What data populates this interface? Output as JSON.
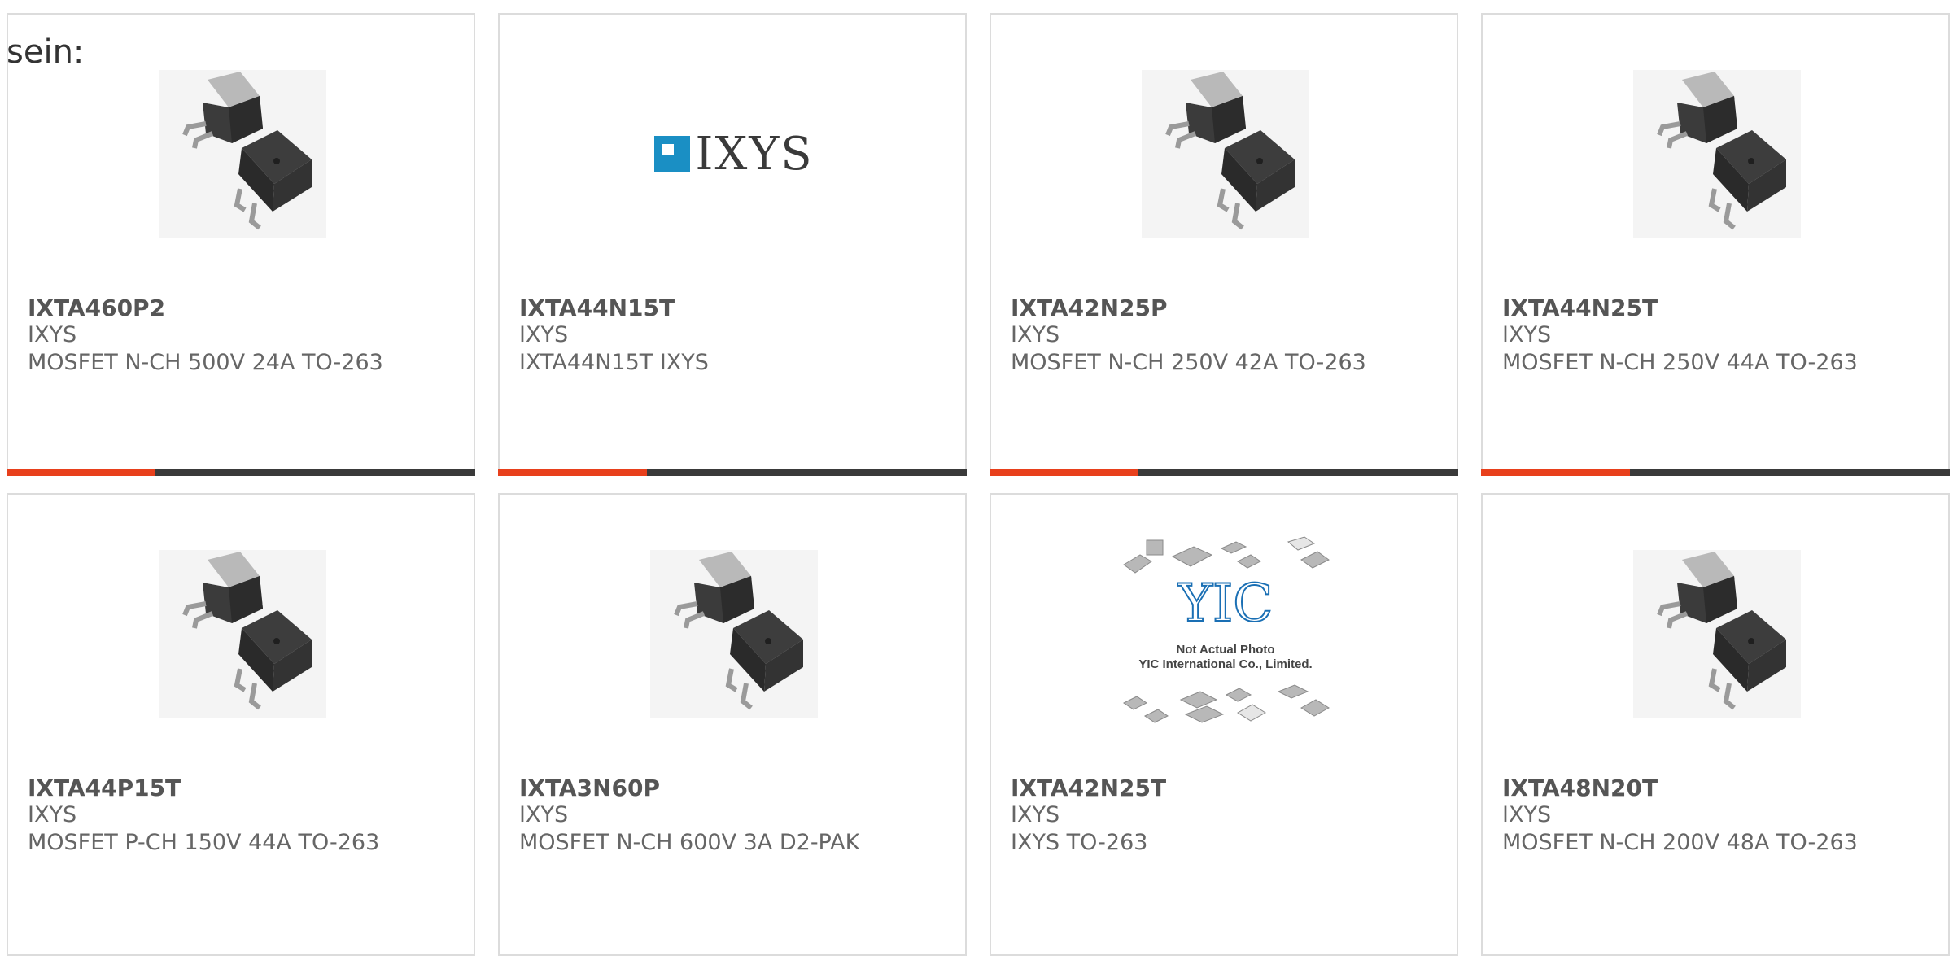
{
  "intro_text": "sein:",
  "products": [
    {
      "part": "IXTA460P2",
      "maker": "IXYS",
      "desc": "MOSFET N-CH 500V 24A TO-263",
      "image": "to263-package"
    },
    {
      "part": "IXTA44N15T",
      "maker": "IXYS",
      "desc": "IXTA44N15T IXYS",
      "image": "ixys-logo",
      "logo_text": "IXYS"
    },
    {
      "part": "IXTA42N25P",
      "maker": "IXYS",
      "desc": "MOSFET N-CH 250V 42A TO-263",
      "image": "to263-package"
    },
    {
      "part": "IXTA44N25T",
      "maker": "IXYS",
      "desc": "MOSFET N-CH 250V 44A TO-263",
      "image": "to263-package"
    },
    {
      "part": "IXTA44P15T",
      "maker": "IXYS",
      "desc": "MOSFET P-CH 150V 44A TO-263",
      "image": "to263-package"
    },
    {
      "part": "IXTA3N60P",
      "maker": "IXYS",
      "desc": "MOSFET N-CH 600V 3A D2-PAK",
      "image": "to263-package"
    },
    {
      "part": "IXTA42N25T",
      "maker": "IXYS",
      "desc": "IXYS TO-263",
      "image": "yic-placeholder",
      "logo_text": "YIC",
      "placeholder_line1": "Not Actual Photo",
      "placeholder_line2": "YIC International Co., Limited."
    },
    {
      "part": "IXTA48N20T",
      "maker": "IXYS",
      "desc": "MOSFET N-CH 200V 48A TO-263",
      "image": "to263-package"
    }
  ],
  "colors": {
    "accent": "#e8401c",
    "bar": "#3a3a3a",
    "border": "#dcdcdc"
  }
}
